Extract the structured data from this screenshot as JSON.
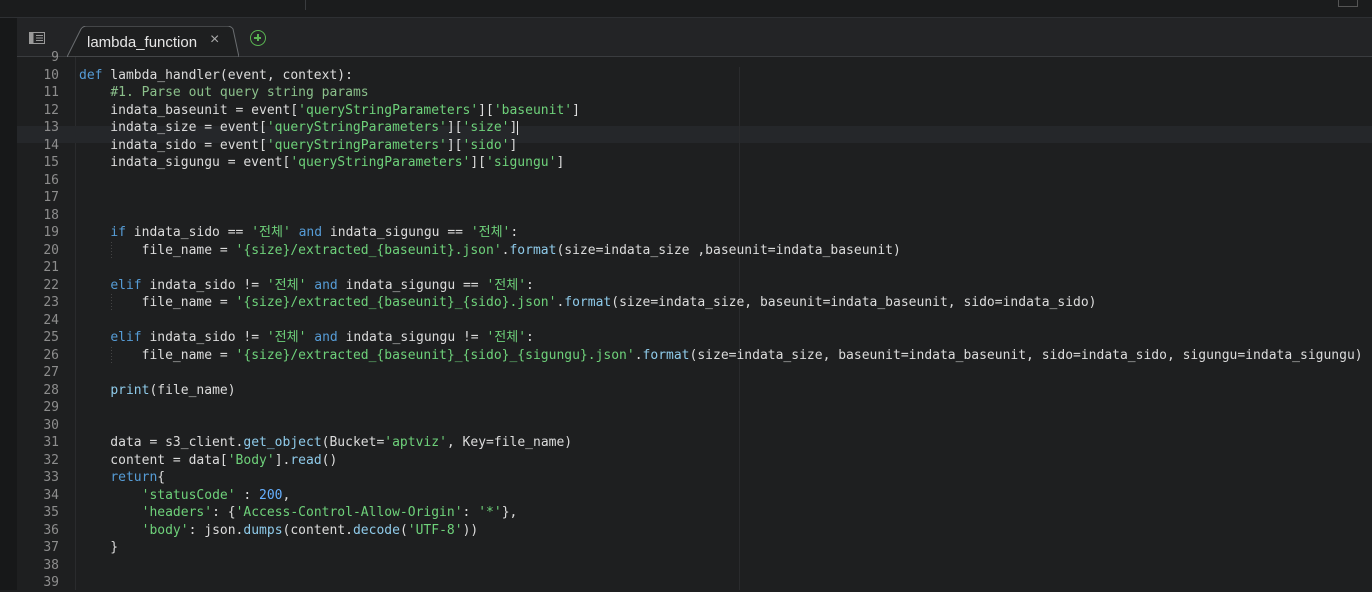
{
  "tabs": [
    {
      "label": "lambda_function",
      "active": true
    }
  ],
  "icons": {
    "panel": "panel-toggle-icon",
    "close": "close-icon",
    "add": "add-tab-icon"
  },
  "colors": {
    "keyword": "#569cd6",
    "string": "#6ed17a",
    "function": "#8fcbea",
    "comment": "#8bc08b",
    "number": "#66b0ff",
    "text": "#dcdcdc",
    "addButton": "#5ab552"
  },
  "editor": {
    "lines": [
      {
        "n": "9",
        "segs": []
      },
      {
        "n": "10",
        "segs": [
          [
            "kw",
            "def"
          ],
          [
            "t",
            " lambda_handler(event, context):"
          ]
        ]
      },
      {
        "n": "11",
        "segs": [
          [
            "t",
            "    "
          ],
          [
            "cm",
            "#1. Parse out query string params"
          ]
        ]
      },
      {
        "n": "12",
        "segs": [
          [
            "t",
            "    indata_baseunit = event["
          ],
          [
            "str",
            "'queryStringParameters'"
          ],
          [
            "t",
            "]["
          ],
          [
            "str",
            "'baseunit'"
          ],
          [
            "t",
            "]"
          ]
        ]
      },
      {
        "n": "13",
        "segs": [
          [
            "t",
            "    indata_size = event["
          ],
          [
            "str",
            "'queryStringParameters'"
          ],
          [
            "t",
            "]["
          ],
          [
            "str",
            "'size'"
          ],
          [
            "t",
            "]"
          ]
        ],
        "cursor": true
      },
      {
        "n": "14",
        "segs": [
          [
            "t",
            "    indata_sido = event["
          ],
          [
            "str",
            "'queryStringParameters'"
          ],
          [
            "t",
            "]["
          ],
          [
            "str",
            "'sido'"
          ],
          [
            "t",
            "]"
          ]
        ]
      },
      {
        "n": "15",
        "segs": [
          [
            "t",
            "    indata_sigungu = event["
          ],
          [
            "str",
            "'queryStringParameters'"
          ],
          [
            "t",
            "]["
          ],
          [
            "str",
            "'sigungu'"
          ],
          [
            "t",
            "]"
          ]
        ]
      },
      {
        "n": "16",
        "segs": []
      },
      {
        "n": "17",
        "segs": []
      },
      {
        "n": "18",
        "segs": []
      },
      {
        "n": "19",
        "segs": [
          [
            "t",
            "    "
          ],
          [
            "kw",
            "if"
          ],
          [
            "t",
            " indata_sido == "
          ],
          [
            "str",
            "'전체'"
          ],
          [
            "t",
            " "
          ],
          [
            "kw",
            "and"
          ],
          [
            "t",
            " indata_sigungu == "
          ],
          [
            "str",
            "'전체'"
          ],
          [
            "t",
            ":"
          ]
        ]
      },
      {
        "n": "20",
        "segs": [
          [
            "t",
            "        file_name = "
          ],
          [
            "str",
            "'{size}/extracted_{baseunit}.json'"
          ],
          [
            "t",
            "."
          ],
          [
            "fn",
            "format"
          ],
          [
            "t",
            "(size=indata_size ,baseunit=indata_baseunit)"
          ]
        ]
      },
      {
        "n": "21",
        "segs": []
      },
      {
        "n": "22",
        "segs": [
          [
            "t",
            "    "
          ],
          [
            "kw",
            "elif"
          ],
          [
            "t",
            " indata_sido != "
          ],
          [
            "str",
            "'전체'"
          ],
          [
            "t",
            " "
          ],
          [
            "kw",
            "and"
          ],
          [
            "t",
            " indata_sigungu == "
          ],
          [
            "str",
            "'전체'"
          ],
          [
            "t",
            ":"
          ]
        ]
      },
      {
        "n": "23",
        "segs": [
          [
            "t",
            "        file_name = "
          ],
          [
            "str",
            "'{size}/extracted_{baseunit}_{sido}.json'"
          ],
          [
            "t",
            "."
          ],
          [
            "fn",
            "format"
          ],
          [
            "t",
            "(size=indata_size, baseunit=indata_baseunit, sido=indata_sido)"
          ]
        ]
      },
      {
        "n": "24",
        "segs": []
      },
      {
        "n": "25",
        "segs": [
          [
            "t",
            "    "
          ],
          [
            "kw",
            "elif"
          ],
          [
            "t",
            " indata_sido != "
          ],
          [
            "str",
            "'전체'"
          ],
          [
            "t",
            " "
          ],
          [
            "kw",
            "and"
          ],
          [
            "t",
            " indata_sigungu != "
          ],
          [
            "str",
            "'전체'"
          ],
          [
            "t",
            ":"
          ]
        ]
      },
      {
        "n": "26",
        "segs": [
          [
            "t",
            "        file_name = "
          ],
          [
            "str",
            "'{size}/extracted_{baseunit}_{sido}_{sigungu}.json'"
          ],
          [
            "t",
            "."
          ],
          [
            "fn",
            "format"
          ],
          [
            "t",
            "(size=indata_size, baseunit=indata_baseunit, sido=indata_sido, sigungu=indata_sigungu)"
          ]
        ]
      },
      {
        "n": "27",
        "segs": []
      },
      {
        "n": "28",
        "segs": [
          [
            "t",
            "    "
          ],
          [
            "fn",
            "print"
          ],
          [
            "t",
            "(file_name)"
          ]
        ]
      },
      {
        "n": "29",
        "segs": []
      },
      {
        "n": "30",
        "segs": []
      },
      {
        "n": "31",
        "segs": [
          [
            "t",
            "    data = s3_client."
          ],
          [
            "fn",
            "get_object"
          ],
          [
            "t",
            "(Bucket="
          ],
          [
            "str",
            "'aptviz'"
          ],
          [
            "t",
            ", Key=file_name)"
          ]
        ]
      },
      {
        "n": "32",
        "segs": [
          [
            "t",
            "    content = data["
          ],
          [
            "str",
            "'Body'"
          ],
          [
            "t",
            "]."
          ],
          [
            "fn",
            "read"
          ],
          [
            "t",
            "()"
          ]
        ]
      },
      {
        "n": "33",
        "segs": [
          [
            "t",
            "    "
          ],
          [
            "kw",
            "return"
          ],
          [
            "t",
            "{"
          ]
        ]
      },
      {
        "n": "34",
        "segs": [
          [
            "t",
            "        "
          ],
          [
            "str",
            "'statusCode'"
          ],
          [
            "t",
            " : "
          ],
          [
            "numc",
            "200"
          ],
          [
            "t",
            ","
          ]
        ]
      },
      {
        "n": "35",
        "segs": [
          [
            "t",
            "        "
          ],
          [
            "str",
            "'headers'"
          ],
          [
            "t",
            ": {"
          ],
          [
            "str",
            "'Access-Control-Allow-Origin'"
          ],
          [
            "t",
            ": "
          ],
          [
            "str",
            "'*'"
          ],
          [
            "t",
            "},"
          ]
        ]
      },
      {
        "n": "36",
        "segs": [
          [
            "t",
            "        "
          ],
          [
            "str",
            "'body'"
          ],
          [
            "t",
            ": json."
          ],
          [
            "fn",
            "dumps"
          ],
          [
            "t",
            "(content."
          ],
          [
            "fn",
            "decode"
          ],
          [
            "t",
            "("
          ],
          [
            "str",
            "'UTF-8'"
          ],
          [
            "t",
            "))"
          ]
        ]
      },
      {
        "n": "37",
        "segs": [
          [
            "t",
            "    }"
          ]
        ]
      },
      {
        "n": "38",
        "segs": []
      },
      {
        "n": "39",
        "segs": []
      }
    ]
  }
}
